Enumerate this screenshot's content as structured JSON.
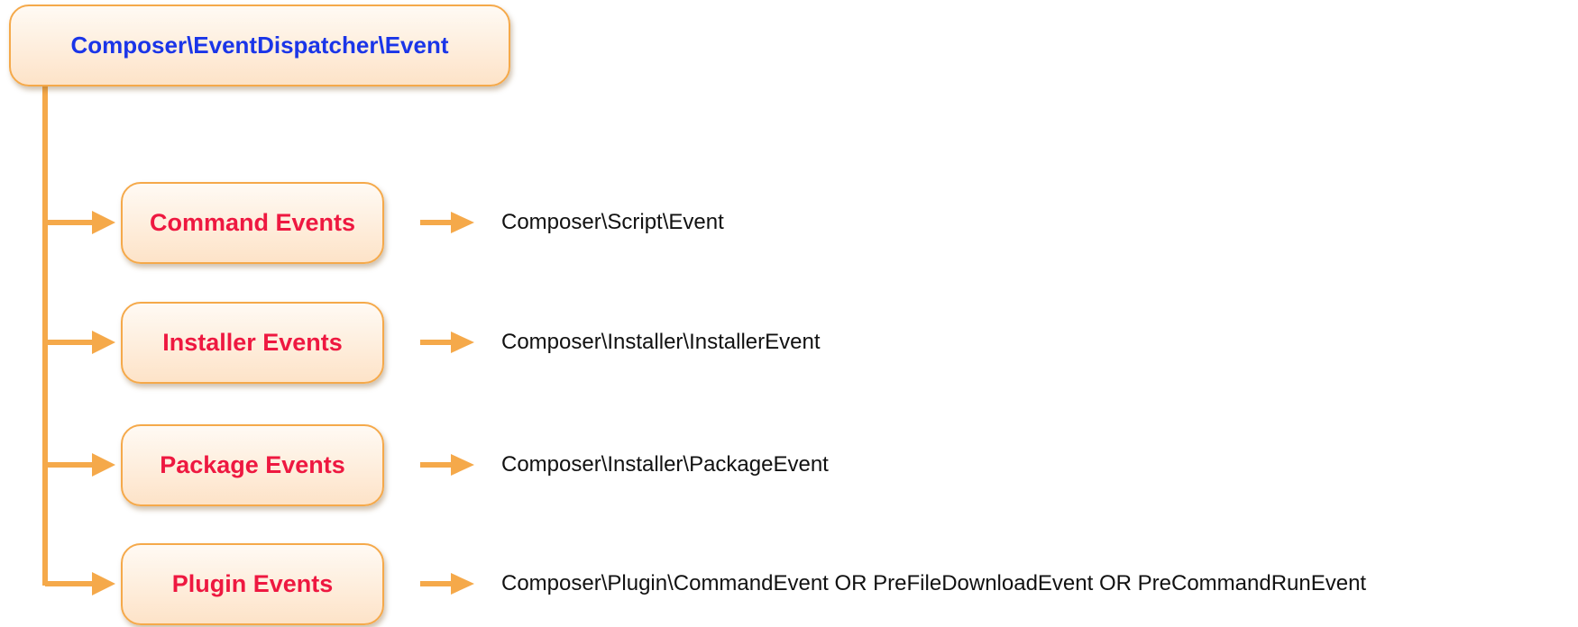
{
  "diagram": {
    "root": {
      "label": "Composer\\EventDispatcher\\Event"
    },
    "categories": [
      {
        "label": "Command Events",
        "event_class": "Composer\\Script\\Event"
      },
      {
        "label": "Installer Events",
        "event_class": "Composer\\Installer\\InstallerEvent"
      },
      {
        "label": "Package Events",
        "event_class": "Composer\\Installer\\PackageEvent"
      },
      {
        "label": "Plugin Events",
        "event_class": "Composer\\Plugin\\CommandEvent OR PreFileDownloadEvent OR PreCommandRunEvent"
      }
    ],
    "colors": {
      "connector": "#f5a94a",
      "box_border": "#f5a94a",
      "root_text": "#1a35e8",
      "category_text": "#ee1840",
      "class_text": "#111111"
    }
  }
}
